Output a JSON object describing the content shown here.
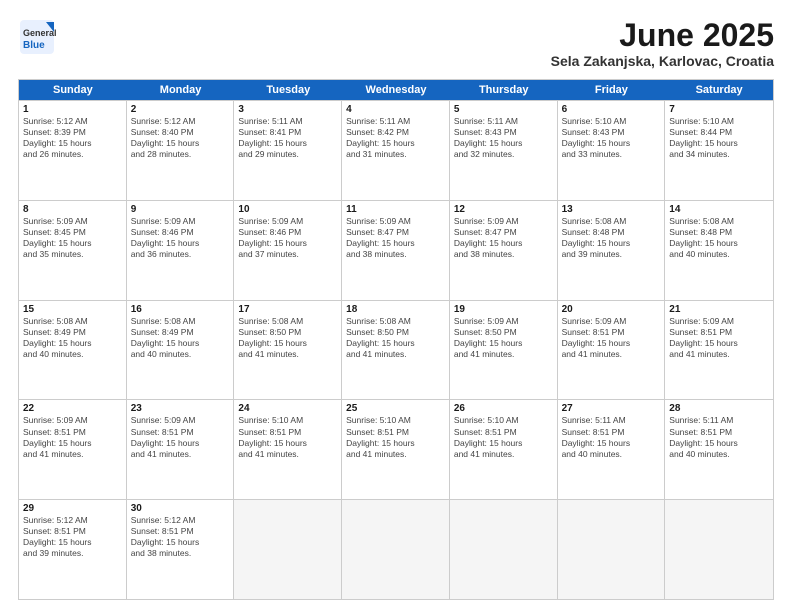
{
  "header": {
    "logo_general": "General",
    "logo_blue": "Blue",
    "title": "June 2025",
    "subtitle": "Sela Zakanjska, Karlovac, Croatia"
  },
  "calendar": {
    "days_of_week": [
      "Sunday",
      "Monday",
      "Tuesday",
      "Wednesday",
      "Thursday",
      "Friday",
      "Saturday"
    ],
    "rows": [
      [
        {
          "day": "",
          "empty": true
        },
        {
          "day": "",
          "empty": true
        },
        {
          "day": "",
          "empty": true
        },
        {
          "day": "",
          "empty": true
        },
        {
          "day": "",
          "empty": true
        },
        {
          "day": "",
          "empty": true
        },
        {
          "day": "",
          "empty": true
        }
      ]
    ]
  },
  "cells": [
    {
      "row": 0,
      "col": 0,
      "day": "",
      "empty": true
    },
    {
      "row": 0,
      "col": 1,
      "day": "",
      "empty": true
    },
    {
      "row": 0,
      "col": 2,
      "day": "",
      "empty": true
    },
    {
      "row": 0,
      "col": 3,
      "day": "",
      "empty": true
    },
    {
      "row": 0,
      "col": 4,
      "day": "",
      "empty": true
    },
    {
      "row": 0,
      "col": 5,
      "day": "",
      "empty": true
    },
    {
      "row": 0,
      "col": 6,
      "day": "",
      "empty": true
    }
  ],
  "week1": [
    {
      "day": "1",
      "sunrise": "Sunrise: 5:12 AM",
      "sunset": "Sunset: 8:39 PM",
      "daylight": "Daylight: 15 hours and 26 minutes."
    },
    {
      "day": "2",
      "sunrise": "Sunrise: 5:12 AM",
      "sunset": "Sunset: 8:40 PM",
      "daylight": "Daylight: 15 hours and 28 minutes."
    },
    {
      "day": "3",
      "sunrise": "Sunrise: 5:11 AM",
      "sunset": "Sunset: 8:41 PM",
      "daylight": "Daylight: 15 hours and 29 minutes."
    },
    {
      "day": "4",
      "sunrise": "Sunrise: 5:11 AM",
      "sunset": "Sunset: 8:42 PM",
      "daylight": "Daylight: 15 hours and 31 minutes."
    },
    {
      "day": "5",
      "sunrise": "Sunrise: 5:11 AM",
      "sunset": "Sunset: 8:43 PM",
      "daylight": "Daylight: 15 hours and 32 minutes."
    },
    {
      "day": "6",
      "sunrise": "Sunrise: 5:10 AM",
      "sunset": "Sunset: 8:43 PM",
      "daylight": "Daylight: 15 hours and 33 minutes."
    },
    {
      "day": "7",
      "sunrise": "Sunrise: 5:10 AM",
      "sunset": "Sunset: 8:44 PM",
      "daylight": "Daylight: 15 hours and 34 minutes."
    }
  ],
  "week2": [
    {
      "day": "8",
      "sunrise": "Sunrise: 5:09 AM",
      "sunset": "Sunset: 8:45 PM",
      "daylight": "Daylight: 15 hours and 35 minutes."
    },
    {
      "day": "9",
      "sunrise": "Sunrise: 5:09 AM",
      "sunset": "Sunset: 8:46 PM",
      "daylight": "Daylight: 15 hours and 36 minutes."
    },
    {
      "day": "10",
      "sunrise": "Sunrise: 5:09 AM",
      "sunset": "Sunset: 8:46 PM",
      "daylight": "Daylight: 15 hours and 37 minutes."
    },
    {
      "day": "11",
      "sunrise": "Sunrise: 5:09 AM",
      "sunset": "Sunset: 8:47 PM",
      "daylight": "Daylight: 15 hours and 38 minutes."
    },
    {
      "day": "12",
      "sunrise": "Sunrise: 5:09 AM",
      "sunset": "Sunset: 8:47 PM",
      "daylight": "Daylight: 15 hours and 38 minutes."
    },
    {
      "day": "13",
      "sunrise": "Sunrise: 5:08 AM",
      "sunset": "Sunset: 8:48 PM",
      "daylight": "Daylight: 15 hours and 39 minutes."
    },
    {
      "day": "14",
      "sunrise": "Sunrise: 5:08 AM",
      "sunset": "Sunset: 8:48 PM",
      "daylight": "Daylight: 15 hours and 40 minutes."
    }
  ],
  "week3": [
    {
      "day": "15",
      "sunrise": "Sunrise: 5:08 AM",
      "sunset": "Sunset: 8:49 PM",
      "daylight": "Daylight: 15 hours and 40 minutes."
    },
    {
      "day": "16",
      "sunrise": "Sunrise: 5:08 AM",
      "sunset": "Sunset: 8:49 PM",
      "daylight": "Daylight: 15 hours and 40 minutes."
    },
    {
      "day": "17",
      "sunrise": "Sunrise: 5:08 AM",
      "sunset": "Sunset: 8:50 PM",
      "daylight": "Daylight: 15 hours and 41 minutes."
    },
    {
      "day": "18",
      "sunrise": "Sunrise: 5:08 AM",
      "sunset": "Sunset: 8:50 PM",
      "daylight": "Daylight: 15 hours and 41 minutes."
    },
    {
      "day": "19",
      "sunrise": "Sunrise: 5:09 AM",
      "sunset": "Sunset: 8:50 PM",
      "daylight": "Daylight: 15 hours and 41 minutes."
    },
    {
      "day": "20",
      "sunrise": "Sunrise: 5:09 AM",
      "sunset": "Sunset: 8:51 PM",
      "daylight": "Daylight: 15 hours and 41 minutes."
    },
    {
      "day": "21",
      "sunrise": "Sunrise: 5:09 AM",
      "sunset": "Sunset: 8:51 PM",
      "daylight": "Daylight: 15 hours and 41 minutes."
    }
  ],
  "week4": [
    {
      "day": "22",
      "sunrise": "Sunrise: 5:09 AM",
      "sunset": "Sunset: 8:51 PM",
      "daylight": "Daylight: 15 hours and 41 minutes."
    },
    {
      "day": "23",
      "sunrise": "Sunrise: 5:09 AM",
      "sunset": "Sunset: 8:51 PM",
      "daylight": "Daylight: 15 hours and 41 minutes."
    },
    {
      "day": "24",
      "sunrise": "Sunrise: 5:10 AM",
      "sunset": "Sunset: 8:51 PM",
      "daylight": "Daylight: 15 hours and 41 minutes."
    },
    {
      "day": "25",
      "sunrise": "Sunrise: 5:10 AM",
      "sunset": "Sunset: 8:51 PM",
      "daylight": "Daylight: 15 hours and 41 minutes."
    },
    {
      "day": "26",
      "sunrise": "Sunrise: 5:10 AM",
      "sunset": "Sunset: 8:51 PM",
      "daylight": "Daylight: 15 hours and 41 minutes."
    },
    {
      "day": "27",
      "sunrise": "Sunrise: 5:11 AM",
      "sunset": "Sunset: 8:51 PM",
      "daylight": "Daylight: 15 hours and 40 minutes."
    },
    {
      "day": "28",
      "sunrise": "Sunrise: 5:11 AM",
      "sunset": "Sunset: 8:51 PM",
      "daylight": "Daylight: 15 hours and 40 minutes."
    }
  ],
  "week5": [
    {
      "day": "29",
      "sunrise": "Sunrise: 5:12 AM",
      "sunset": "Sunset: 8:51 PM",
      "daylight": "Daylight: 15 hours and 39 minutes."
    },
    {
      "day": "30",
      "sunrise": "Sunrise: 5:12 AM",
      "sunset": "Sunset: 8:51 PM",
      "daylight": "Daylight: 15 hours and 38 minutes."
    },
    {
      "day": "",
      "empty": true
    },
    {
      "day": "",
      "empty": true
    },
    {
      "day": "",
      "empty": true
    },
    {
      "day": "",
      "empty": true
    },
    {
      "day": "",
      "empty": true
    }
  ]
}
